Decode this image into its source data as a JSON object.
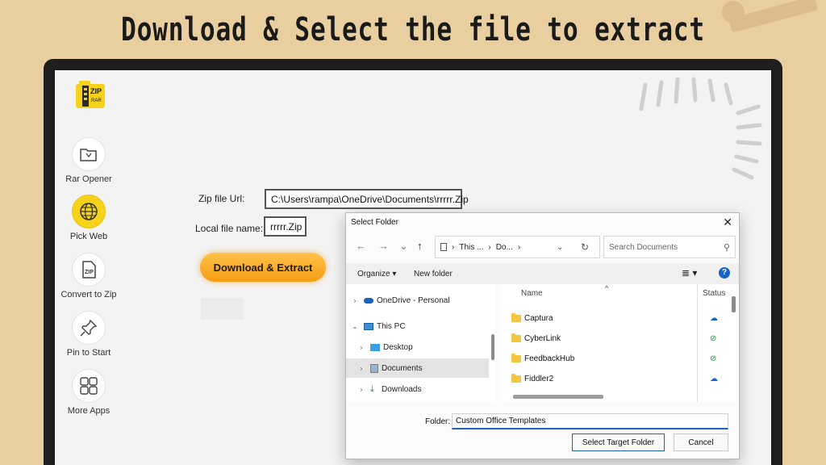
{
  "headline": "Download & Select the file to extract",
  "logo": {
    "text_top": "ZIP",
    "text_bottom": "RAR"
  },
  "sidebar": {
    "items": [
      {
        "label": "Rar Opener",
        "icon": "folder-open-icon",
        "active": false
      },
      {
        "label": "Pick Web",
        "icon": "globe-icon",
        "active": true
      },
      {
        "label": "Convert to Zip",
        "icon": "zip-file-icon",
        "active": false
      },
      {
        "label": "Pin to Start",
        "icon": "pin-icon",
        "active": false
      },
      {
        "label": "More Apps",
        "icon": "grid-icon",
        "active": false
      }
    ]
  },
  "form": {
    "zip_url_label": "Zip file Url:",
    "zip_url_value": "C:\\Users\\rampa\\OneDrive\\Documents\\rrrrr.Zip",
    "local_name_label": "Local file name:",
    "local_name_value": "rrrrr.Zip",
    "download_button": "Download & Extract"
  },
  "dialog": {
    "title": "Select Folder",
    "breadcrumb": [
      "This ...",
      "Do..."
    ],
    "search_placeholder": "Search Documents",
    "organize_label": "Organize",
    "new_folder_label": "New folder",
    "tree": [
      {
        "label": "OneDrive - Personal",
        "icon": "cloud-icon",
        "indent": 0,
        "chevron": ">"
      },
      {
        "label": "This PC",
        "icon": "monitor-icon",
        "indent": 0,
        "chevron": "v"
      },
      {
        "label": "Desktop",
        "icon": "desktop-icon",
        "indent": 1,
        "chevron": ">"
      },
      {
        "label": "Documents",
        "icon": "document-icon",
        "indent": 1,
        "chevron": ">",
        "selected": true
      },
      {
        "label": "Downloads",
        "icon": "download-icon",
        "indent": 1,
        "chevron": ">"
      }
    ],
    "columns": {
      "name": "Name",
      "status": "Status"
    },
    "files": [
      {
        "name": "Captura",
        "status": "cloud"
      },
      {
        "name": "CyberLink",
        "status": "synced"
      },
      {
        "name": "FeedbackHub",
        "status": "synced"
      },
      {
        "name": "Fiddler2",
        "status": "cloud"
      }
    ],
    "folder_label": "Folder:",
    "folder_value": "Custom Office Templates",
    "select_button": "Select Target Folder",
    "cancel_button": "Cancel"
  },
  "colors": {
    "background": "#e9cfa0",
    "accent_orange": "#f59c12",
    "active_nav": "#f6d21a",
    "win_blue": "#1a63c5"
  }
}
